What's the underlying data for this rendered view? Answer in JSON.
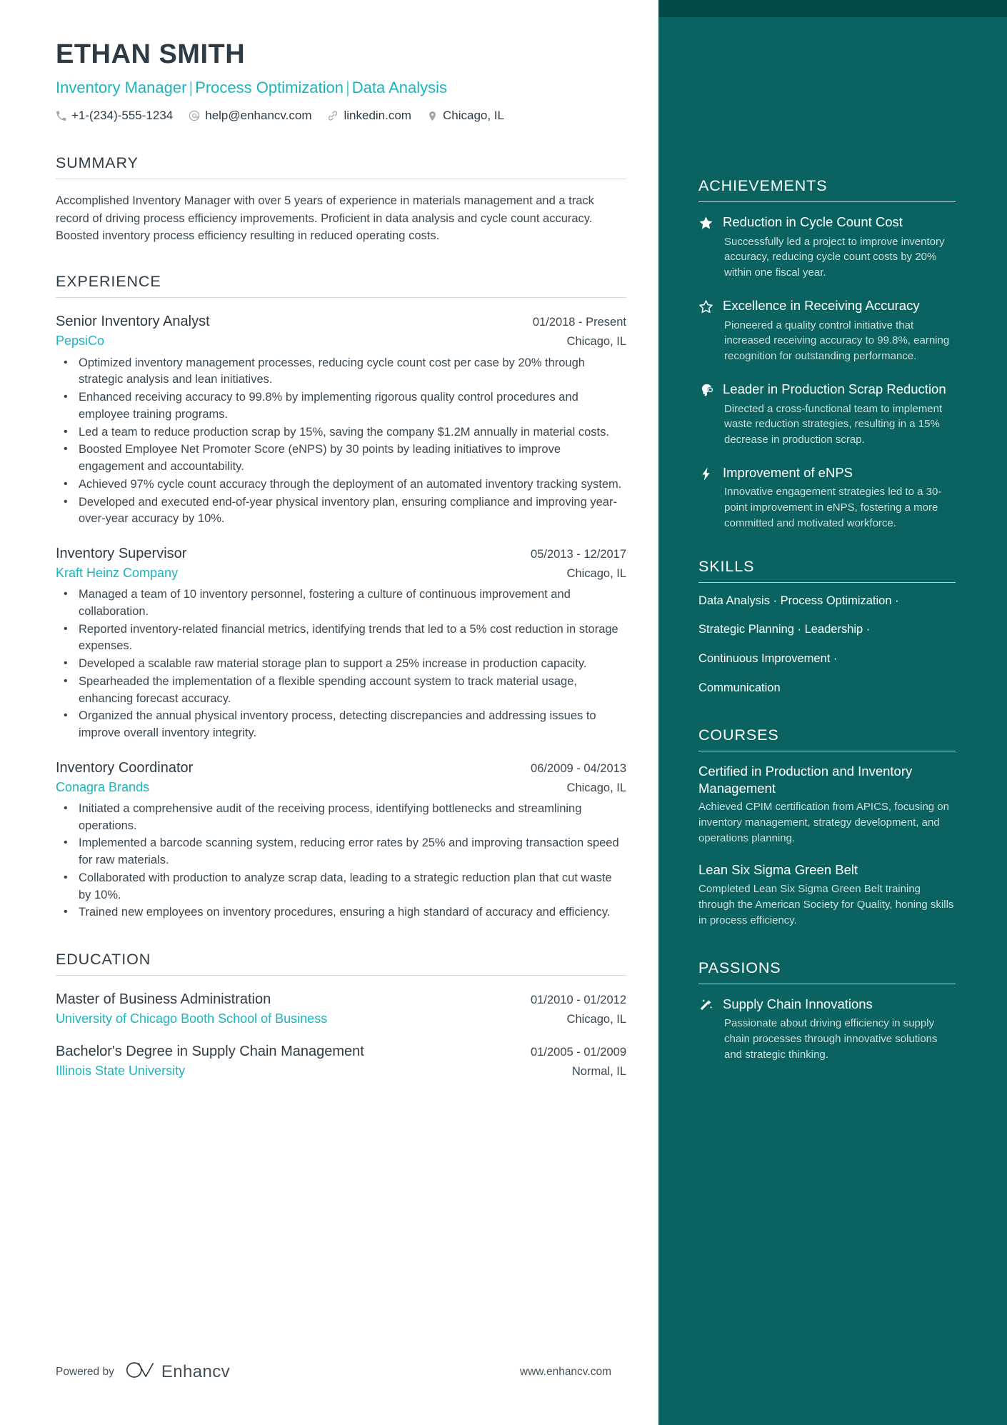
{
  "colors": {
    "accent_teal": "#19b5be",
    "sidebar_bg": "#0a6360",
    "sidebar_top_strip": "#034b49",
    "ink": "#2e3b44",
    "body_text": "#3b4750",
    "sidebar_muted": "#cfdfde"
  },
  "header": {
    "name": "ETHAN SMITH",
    "headline_parts": [
      "Inventory Manager",
      "Process Optimization",
      "Data Analysis"
    ],
    "headline_separator": "|",
    "contacts": [
      {
        "icon": "phone-icon",
        "text": "+1-(234)-555-1234"
      },
      {
        "icon": "email-icon",
        "text": "help@enhancv.com"
      },
      {
        "icon": "link-icon",
        "text": "linkedin.com"
      },
      {
        "icon": "location-pin-icon",
        "text": "Chicago, IL"
      }
    ]
  },
  "summary": {
    "heading": "SUMMARY",
    "text": "Accomplished Inventory Manager with over 5 years of experience in materials management and a track record of driving process efficiency improvements. Proficient in data analysis and cycle count accuracy. Boosted inventory process efficiency resulting in reduced operating costs."
  },
  "experience": {
    "heading": "EXPERIENCE",
    "items": [
      {
        "title": "Senior Inventory Analyst",
        "dates": "01/2018 - Present",
        "company": "PepsiCo",
        "location": "Chicago, IL",
        "bullets": [
          "Optimized inventory management processes, reducing cycle count cost per case by 20% through strategic analysis and lean initiatives.",
          "Enhanced receiving accuracy to 99.8% by implementing rigorous quality control procedures and employee training programs.",
          "Led a team to reduce production scrap by 15%, saving the company $1.2M annually in material costs.",
          "Boosted Employee Net Promoter Score (eNPS) by 30 points by leading initiatives to improve engagement and accountability.",
          "Achieved 97% cycle count accuracy through the deployment of an automated inventory tracking system.",
          "Developed and executed end-of-year physical inventory plan, ensuring compliance and improving year-over-year accuracy by 10%."
        ]
      },
      {
        "title": "Inventory Supervisor",
        "dates": "05/2013 - 12/2017",
        "company": "Kraft Heinz Company",
        "location": "Chicago, IL",
        "bullets": [
          "Managed a team of 10 inventory personnel, fostering a culture of continuous improvement and collaboration.",
          "Reported inventory-related financial metrics, identifying trends that led to a 5% cost reduction in storage expenses.",
          "Developed a scalable raw material storage plan to support a 25% increase in production capacity.",
          "Spearheaded the implementation of a flexible spending account system to track material usage, enhancing forecast accuracy.",
          "Organized the annual physical inventory process, detecting discrepancies and addressing issues to improve overall inventory integrity."
        ]
      },
      {
        "title": "Inventory Coordinator",
        "dates": "06/2009 - 04/2013",
        "company": "Conagra Brands",
        "location": "Chicago, IL",
        "bullets": [
          "Initiated a comprehensive audit of the receiving process, identifying bottlenecks and streamlining operations.",
          "Implemented a barcode scanning system, reducing error rates by 25% and improving transaction speed for raw materials.",
          "Collaborated with production to analyze scrap data, leading to a strategic reduction plan that cut waste by 10%.",
          "Trained new employees on inventory procedures, ensuring a high standard of accuracy and efficiency."
        ]
      }
    ]
  },
  "education": {
    "heading": "EDUCATION",
    "items": [
      {
        "degree": "Master of Business Administration",
        "dates": "01/2010 - 01/2012",
        "school": "University of Chicago Booth School of Business",
        "location": "Chicago, IL"
      },
      {
        "degree": "Bachelor's Degree in Supply Chain Management",
        "dates": "01/2005 - 01/2009",
        "school": "Illinois State University",
        "location": "Normal, IL"
      }
    ]
  },
  "achievements": {
    "heading": "ACHIEVEMENTS",
    "items": [
      {
        "icon": "star-filled-icon",
        "title": "Reduction in Cycle Count Cost",
        "description": "Successfully led a project to improve inventory accuracy, reducing cycle count costs by 20% within one fiscal year."
      },
      {
        "icon": "star-outline-icon",
        "title": "Excellence in Receiving Accuracy",
        "description": "Pioneered a quality control initiative that increased receiving accuracy to 99.8%, earning recognition for outstanding performance."
      },
      {
        "icon": "head-brain-icon",
        "title": "Leader in Production Scrap Reduction",
        "description": "Directed a cross-functional team to implement waste reduction strategies, resulting in a 15% decrease in production scrap."
      },
      {
        "icon": "lightning-bolt-icon",
        "title": "Improvement of eNPS",
        "description": "Innovative engagement strategies led to a 30-point improvement in eNPS, fostering a more committed and motivated workforce."
      }
    ]
  },
  "skills": {
    "heading": "SKILLS",
    "lines": [
      "Data Analysis · Process Optimization ·",
      "Strategic Planning · Leadership ·",
      "Continuous Improvement ·",
      "Communication"
    ]
  },
  "courses": {
    "heading": "COURSES",
    "items": [
      {
        "title": "Certified in Production and Inventory Management",
        "description": "Achieved CPIM certification from APICS, focusing on inventory management, strategy development, and operations planning."
      },
      {
        "title": "Lean Six Sigma Green Belt",
        "description": "Completed Lean Six Sigma Green Belt training through the American Society for Quality, honing skills in process efficiency."
      }
    ]
  },
  "passions": {
    "heading": "PASSIONS",
    "items": [
      {
        "icon": "magic-wand-icon",
        "title": "Supply Chain Innovations",
        "description": "Passionate about driving efficiency in supply chain processes through innovative solutions and strategic thinking."
      }
    ]
  },
  "footer": {
    "powered_by": "Powered by",
    "brand": "Enhancv",
    "url": "www.enhancv.com"
  }
}
